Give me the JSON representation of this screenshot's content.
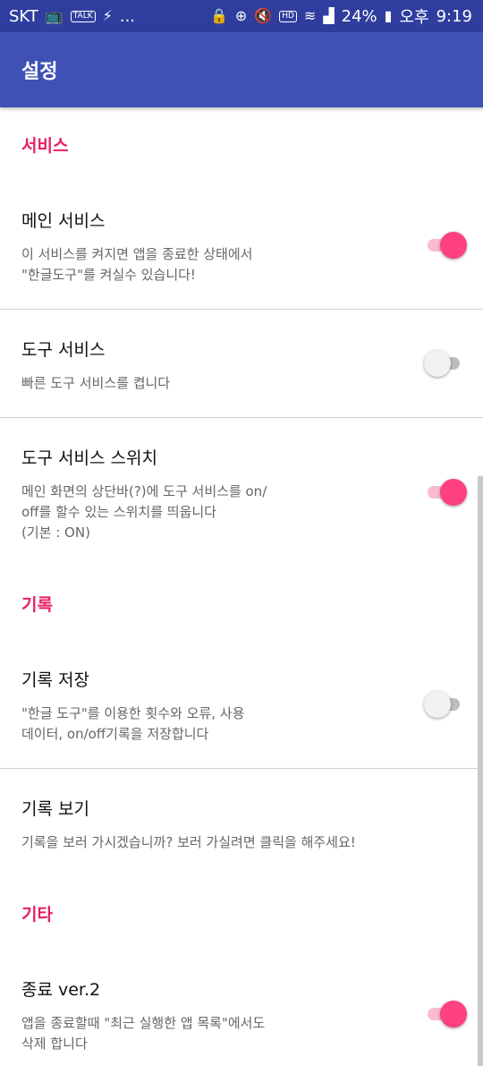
{
  "status_bar": {
    "carrier": "SKT",
    "left_icons": [
      "tv-icon",
      "talk-icon",
      "bolt-icon"
    ],
    "more": "...",
    "battery": "24%",
    "time_label": "오후",
    "time": "9:19"
  },
  "app_bar": {
    "title": "설정"
  },
  "sections": [
    {
      "header": "서비스",
      "prefs": [
        {
          "title": "메인 서비스",
          "summary": "이 서비스를 켜지면 앱을 종료한 상태에서\n\"한글도구\"를 켜실수 있습니다!",
          "enabled": true
        },
        {
          "title": "도구 서비스",
          "summary": "빠른 도구 서비스를 켭니다",
          "enabled": false
        },
        {
          "title": "도구 서비스 스위치",
          "summary": "메인 화면의 상단바(?)에 도구 서비스를 on/\noff를 할수 있는 스위치를 띄웁니다\n(기본 : ON)",
          "enabled": true
        }
      ]
    },
    {
      "header": "기록",
      "prefs": [
        {
          "title": "기록 저장",
          "summary": "\"한글 도구\"를 이용한 횟수와 오류, 사용\n데이터, on/off기록을 저장합니다",
          "enabled": false
        },
        {
          "title": "기록 보기",
          "summary": "기록을 보러 가시겠습니까? 보러 가실려면 클릭을 해주세요!"
        }
      ]
    },
    {
      "header": "기타",
      "prefs": [
        {
          "title": "종료 ver.2",
          "summary": "앱을 종료할때 \"최근 실행한 앱 목록\"에서도\n삭제 합니다",
          "enabled": true
        }
      ]
    }
  ],
  "colors": {
    "status_bar": "#2f3e9e",
    "app_bar": "#3f51b5",
    "accent": "#e91e63",
    "switch_on": "#ff4081"
  }
}
